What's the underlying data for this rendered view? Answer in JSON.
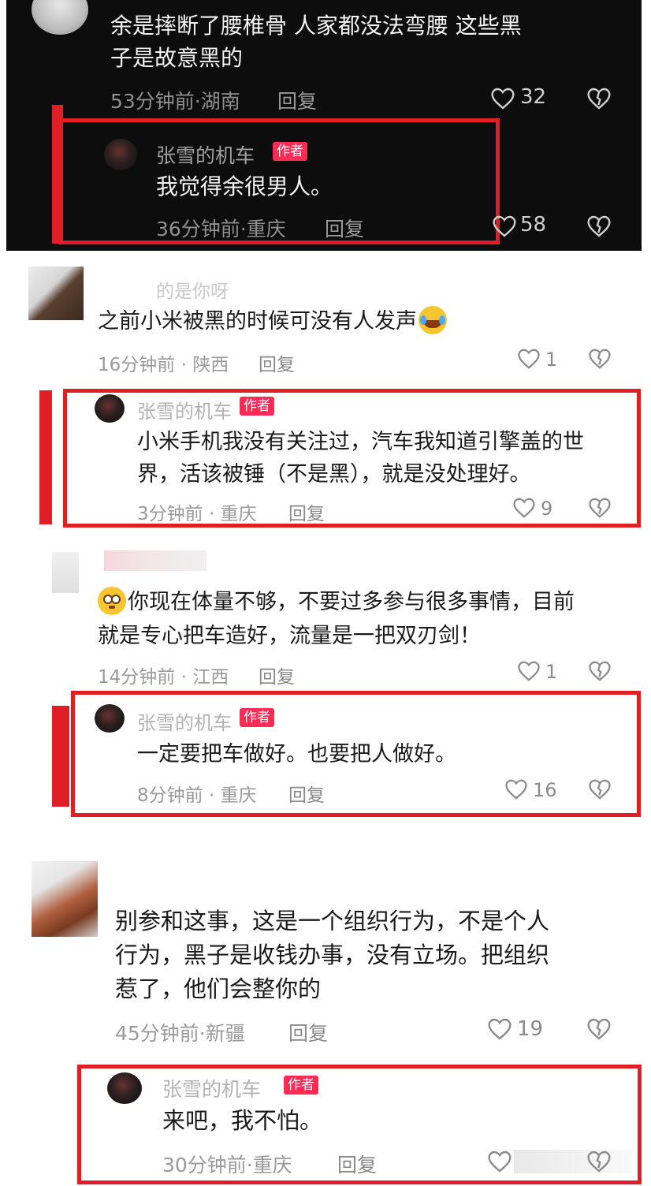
{
  "colors": {
    "accent_red": "#e01e26",
    "badge_pink": "#fe2c55",
    "dark_bg": "#0d0d0d"
  },
  "c1": {
    "text_l1": "余是摔断了腰椎骨  人家都没法弯腰    这些黑",
    "text_l2": "子是故意黑的",
    "meta": "53分钟前·湖南",
    "reply": "回复",
    "likes": "32"
  },
  "r1": {
    "name": "张雪的机车",
    "badge": "作者",
    "text": "我觉得余很男人。",
    "meta": "36分钟前·重庆",
    "reply": "回复",
    "likes": "58"
  },
  "c2": {
    "name": "的是你呀",
    "text": "之前小米被黑的时候可没有人发声",
    "meta": "16分钟前 · 陕西",
    "reply": "回复",
    "likes": "1"
  },
  "r2": {
    "name": "张雪的机车",
    "badge": "作者",
    "text_l1": "小米手机我没有关注过，汽车我知道引擎盖的世",
    "text_l2": "界，活该被锤（不是黑），就是没处理好。",
    "meta": "3分钟前 · 重庆",
    "reply": "回复",
    "likes": "9"
  },
  "c3": {
    "text_l1": "你现在体量不够，不要过多参与很多事情，目前",
    "text_l2": "就是专心把车造好，流量是一把双刃剑！",
    "meta": "14分钟前 · 江西",
    "reply": "回复",
    "likes": "1"
  },
  "r3": {
    "name": "张雪的机车",
    "badge": "作者",
    "text": "一定要把车做好。也要把人做好。",
    "meta": "8分钟前 · 重庆",
    "reply": "回复",
    "likes": "16"
  },
  "c4": {
    "text_l1": "别参和这事，这是一个组织行为，不是个人",
    "text_l2": "行为，黑子是收钱办事，没有立场。把组织",
    "text_l3": "惹了，他们会整你的",
    "meta": "45分钟前·新疆",
    "reply": "回复",
    "likes": "19"
  },
  "r4": {
    "name": "张雪的机车",
    "badge": "作者",
    "text": "来吧，我不怕。",
    "meta": "30分钟前·重庆",
    "reply": "回复"
  },
  "icons": {
    "like": "heart-outline-icon",
    "dislike": "broken-heart-icon",
    "laugh_cry": "laughing-crying-emoji",
    "flushed": "flushed-emoji"
  }
}
